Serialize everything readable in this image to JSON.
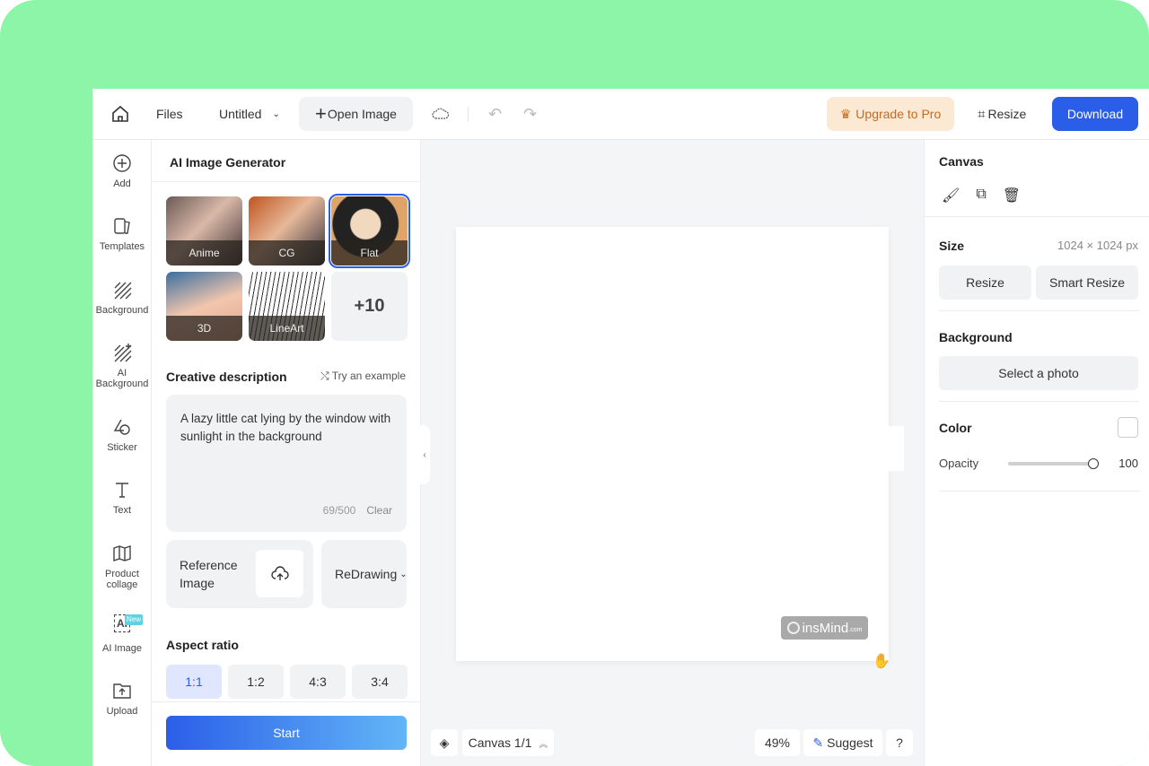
{
  "topbar": {
    "files": "Files",
    "title": "Untitled",
    "open_image": "Open Image",
    "upgrade": "Upgrade to Pro",
    "resize": "Resize",
    "download": "Download"
  },
  "rail": [
    {
      "label": "Add"
    },
    {
      "label": "Templates"
    },
    {
      "label": "Background"
    },
    {
      "label": "AI Background"
    },
    {
      "label": "Sticker"
    },
    {
      "label": "Text"
    },
    {
      "label": "Product collage"
    },
    {
      "label": "AI Image",
      "badge": "New"
    },
    {
      "label": "Upload"
    }
  ],
  "panel": {
    "title": "AI Image Generator",
    "styles": [
      {
        "label": "Anime"
      },
      {
        "label": "CG"
      },
      {
        "label": "Flat",
        "selected": true
      },
      {
        "label": "3D"
      },
      {
        "label": "LineArt"
      }
    ],
    "more": "+10",
    "desc_label": "Creative description",
    "try_example": "Try an example",
    "prompt": "A lazy little cat lying by the window with sunlight in the background",
    "count": "69/500",
    "clear": "Clear",
    "reference": "Reference Image",
    "redrawing": "ReDrawing",
    "aspect_label": "Aspect ratio",
    "aspects": [
      "1:1",
      "1:2",
      "4:3",
      "3:4"
    ],
    "aspect_selected": "1:1",
    "start": "Start"
  },
  "canvas": {
    "watermark": "insMind",
    "watermark_suffix": ".com",
    "page_label": "Canvas 1/1",
    "zoom": "49%",
    "suggest": "Suggest",
    "help": "?"
  },
  "right": {
    "title": "Canvas",
    "size_label": "Size",
    "size_value": "1024 × 1024 px",
    "resize": "Resize",
    "smart_resize": "Smart Resize",
    "bg_label": "Background",
    "select_photo": "Select a photo",
    "color_label": "Color",
    "opacity_label": "Opacity",
    "opacity_value": "100"
  },
  "colors": {
    "accent": "#2b5ee8",
    "upgrade": "#c56a22",
    "bg": "#8cf5a8"
  }
}
